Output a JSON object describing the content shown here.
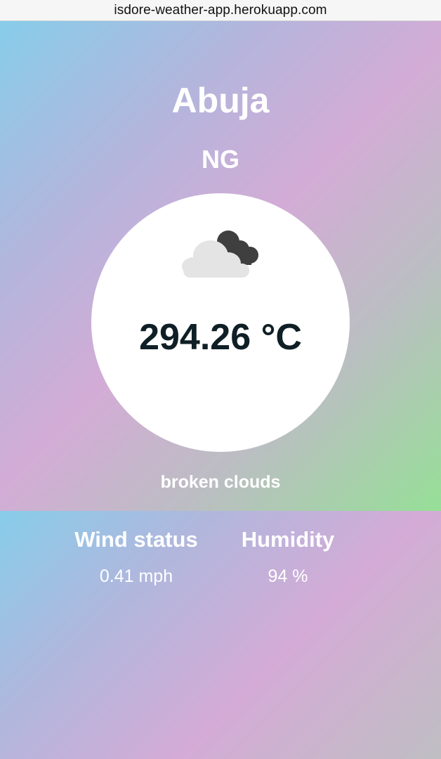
{
  "browser": {
    "url": "isdore-weather-app.herokuapp.com"
  },
  "weather": {
    "city": "Abuja",
    "country": "NG",
    "icon": "broken-clouds-icon",
    "temperature": "294.26 °C",
    "description": "broken clouds"
  },
  "stats": {
    "wind": {
      "title": "Wind status",
      "value": "0.41 mph"
    },
    "humidity": {
      "title": "Humidity",
      "value": "94 %"
    }
  },
  "colors": {
    "gradient": [
      "#87cdea",
      "#b4b5dc",
      "#d3acd6",
      "#bcbdc3",
      "#96df97"
    ],
    "text_light": "#ffffff",
    "text_dark": "#0f1f26",
    "card": "#ffffff"
  }
}
